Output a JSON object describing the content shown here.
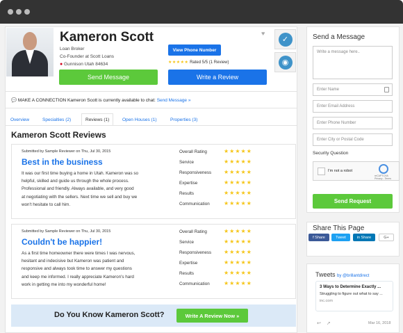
{
  "profile": {
    "name": "Kameron Scott",
    "title": "Loan Broker",
    "company": "Co-Founder at Scott Loans",
    "location": "Gunnison Utah 84634",
    "phone_button": "View Phone Number",
    "rating_text": "Rated 5/5 (1 Review)",
    "send_message": "Send Message",
    "write_review": "Write a Review"
  },
  "connection": {
    "prefix": "MAKE A CONNECTION Kameron Scott is currently available to chat:",
    "link": "Send Message »"
  },
  "tabs": [
    {
      "label": "Overview"
    },
    {
      "label": "Specialties (2)"
    },
    {
      "label": "Reviews (1)"
    },
    {
      "label": "Open Houses (1)"
    },
    {
      "label": "Properties (3)"
    }
  ],
  "reviews_heading": "Kameron Scott Reviews",
  "reviews": [
    {
      "submitted": "Submitted by Sample Reviewer on Thu, Jul 30, 2015",
      "title": "Best in the business",
      "lines": [
        "It was our first time buying a home in Utah. Kameron was so",
        "helpful, skilled and guide us through the whole process.",
        "Professional and friendly. Always available, and very good",
        "at negotiating with the sellers. Next time we sell and buy we",
        "won't hesitate to call him."
      ]
    },
    {
      "submitted": "Submitted by Sample Reviewer on Thu, Jul 30, 2015",
      "title": "Couldn't be happier!",
      "lines": [
        "As a first time homeowner there were times I was nervous,",
        "hesitant and indecisive but Kameron was patient and",
        "responsive and always took time to answer my questions",
        "and keep me informed. I really appreciate Kameron's hard",
        "work in getting me into my wonderful home!"
      ]
    }
  ],
  "rating_categories": [
    "Overall Rating",
    "Service",
    "Responsiveness",
    "Expertise",
    "Results",
    "Communication"
  ],
  "stars": "★★★★★",
  "cta": {
    "question": "Do You Know Kameron Scott?",
    "button": "Write A Review Now »"
  },
  "sidebar": {
    "send_title": "Send a Message",
    "message_placeholder": "Write a message here..",
    "fields": [
      "Enter Name",
      "Enter Email Address",
      "Enter Phone Number",
      "Enter City or Postal Code"
    ],
    "security_label": "Security Question",
    "captcha_label": "I'm not a robot",
    "captcha_brand": "reCAPTCHA",
    "captcha_terms": "Privacy - Terms",
    "send_request": "Send Request",
    "share_title": "Share This Page",
    "share": {
      "facebook": "f Share",
      "twitter": "Tweet",
      "linkedin": "in Share",
      "google": "G+"
    },
    "tweets_title": "Tweets",
    "tweets_by": "by @brillantdirect",
    "tweet_headline": "3 Ways to Determine Exactly ...",
    "tweet_text": "Struggling to figure out what to say ...",
    "tweet_domain": "inc.com",
    "tweet_date": "Mar 16, 2018"
  },
  "colors": {
    "primary": "#1a73e8",
    "success": "#5cc93b",
    "star": "#f5c518",
    "badge": "#3f93c9"
  }
}
